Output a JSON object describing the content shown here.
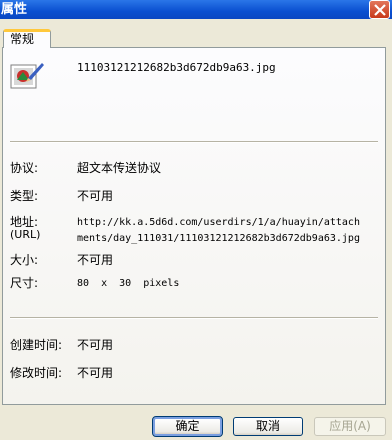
{
  "window": {
    "title": "属性"
  },
  "tabs": [
    {
      "label": "常规"
    }
  ],
  "file": {
    "name": "11103121212682b3d672db9a63.jpg"
  },
  "properties": {
    "protocol": {
      "label": "协议:",
      "value": "超文本传送协议"
    },
    "type": {
      "label": "类型:",
      "value": "不可用"
    },
    "address": {
      "label": "地址:",
      "label_sub": "(URL)",
      "value_line1": "http://kk.a.5d6d.com/userdirs/1/a/huayin/attach",
      "value_line2": "ments/day_111031/11103121212682b3d672db9a63.jpg"
    },
    "size": {
      "label": "大小:",
      "value": "不可用"
    },
    "dimensions": {
      "label": "尺寸:",
      "value": "80  x  30  pixels"
    },
    "created": {
      "label": "创建时间:",
      "value": "不可用"
    },
    "modified": {
      "label": "修改时间:",
      "value": "不可用"
    }
  },
  "buttons": {
    "ok": "确定",
    "cancel": "取消",
    "apply": "应用(A)"
  }
}
